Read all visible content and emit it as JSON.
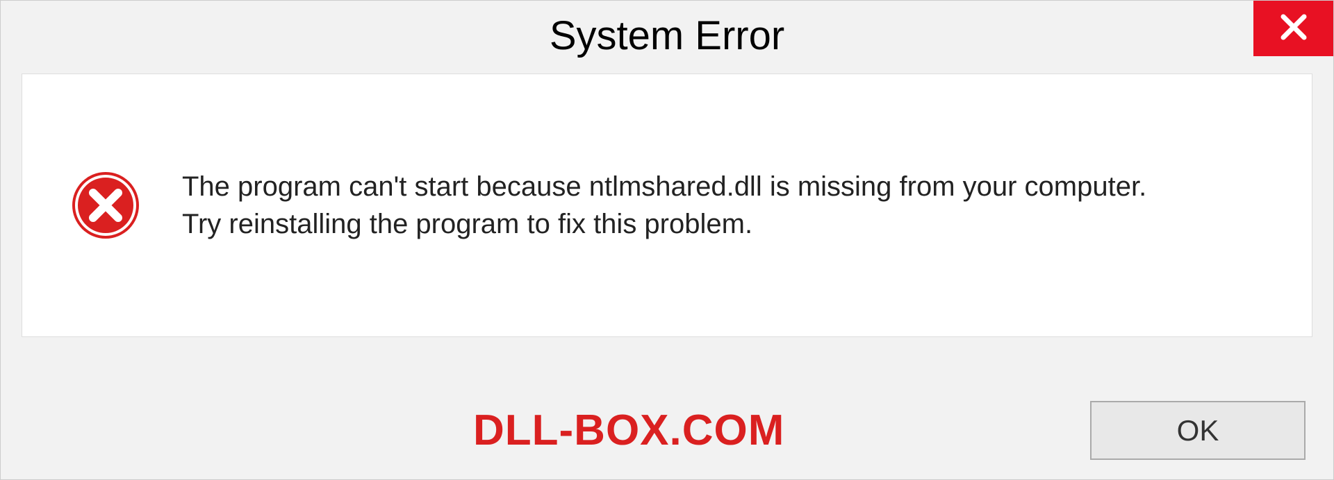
{
  "dialog": {
    "title": "System Error",
    "message": "The program can't start because ntlmshared.dll is missing from your computer. Try reinstalling the program to fix this problem.",
    "ok_label": "OK"
  },
  "watermark": "DLL-BOX.COM"
}
